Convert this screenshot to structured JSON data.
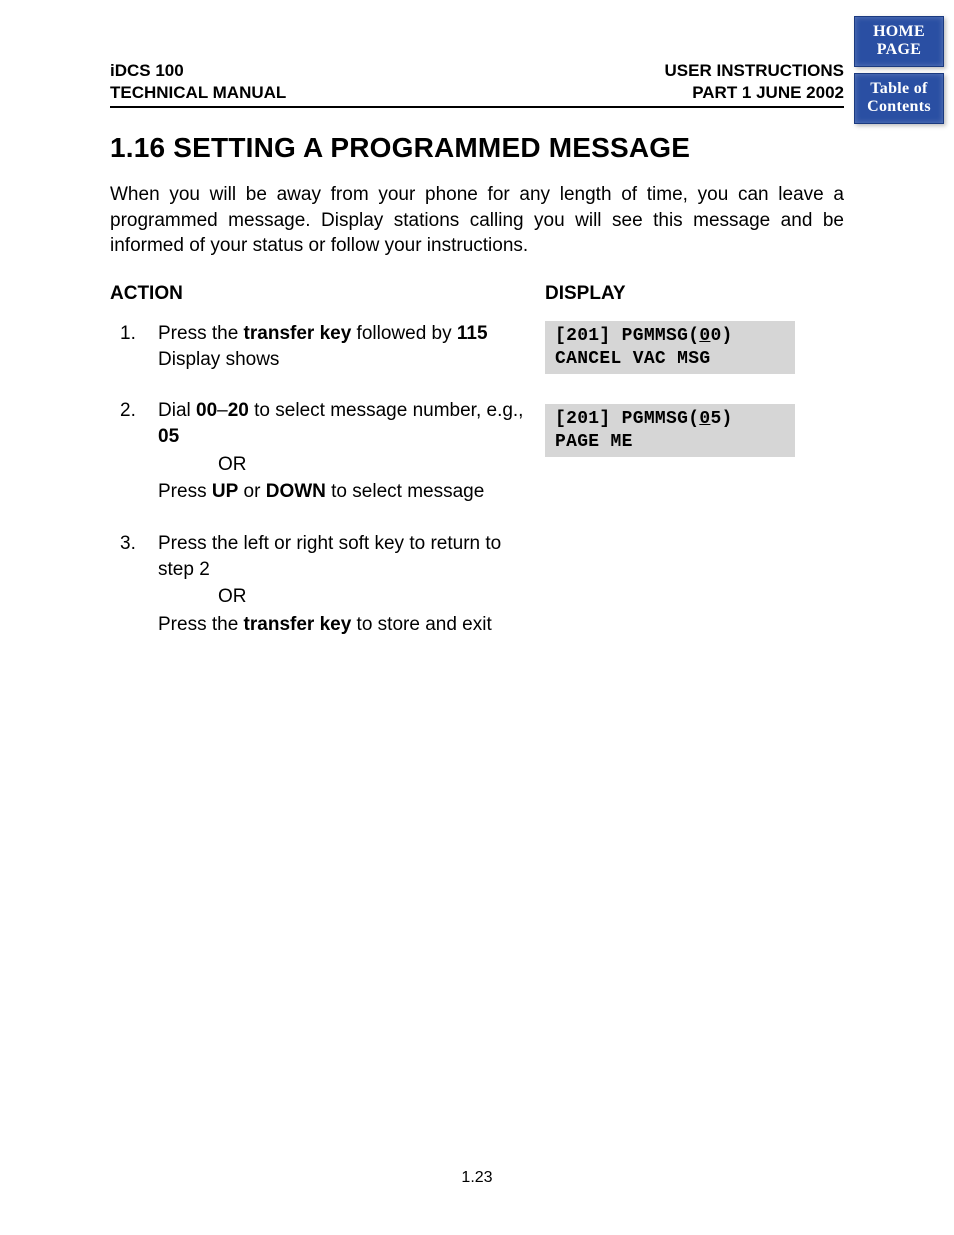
{
  "nav": {
    "home": "HOME\nPAGE",
    "toc": "Table of\nContents"
  },
  "header": {
    "left1": "iDCS 100",
    "left2": "TECHNICAL MANUAL",
    "right1": "USER INSTRUCTIONS",
    "right2": "PART 1   JUNE  2002"
  },
  "title": "1.16 SETTING A PROGRAMMED MESSAGE",
  "intro": "When you will be away from your phone for any length of time, you can leave a programmed message. Display stations calling you will see this message and be informed of your status or follow your instructions.",
  "labels": {
    "action": "ACTION",
    "display": "DISPLAY"
  },
  "steps": {
    "s1_a": "Press the ",
    "s1_b": "transfer key",
    "s1_c": " followed by ",
    "s1_d": "115",
    "s1_e": "Display shows",
    "s2_a": "Dial ",
    "s2_b": "00",
    "s2_c": "–",
    "s2_d": "20",
    "s2_e": " to select message number, e.g., ",
    "s2_f": "05",
    "s2_or": "OR",
    "s2_g": "Press ",
    "s2_h": "UP",
    "s2_i": " or ",
    "s2_j": "DOWN",
    "s2_k": " to select message",
    "s3_a": "Press the left or right soft key to return to step 2",
    "s3_or": "OR",
    "s3_b": "Press the ",
    "s3_c": "transfer key",
    "s3_d": " to store and exit"
  },
  "displays": {
    "d1_l1a": "[201] PGMMSG(",
    "d1_l1u": "0",
    "d1_l1b": "0)",
    "d1_l2": "CANCEL VAC MSG",
    "d2_l1a": "[201] PGMMSG(",
    "d2_l1u": "0",
    "d2_l1b": "5)",
    "d2_l2": "PAGE ME"
  },
  "page_number": "1.23"
}
